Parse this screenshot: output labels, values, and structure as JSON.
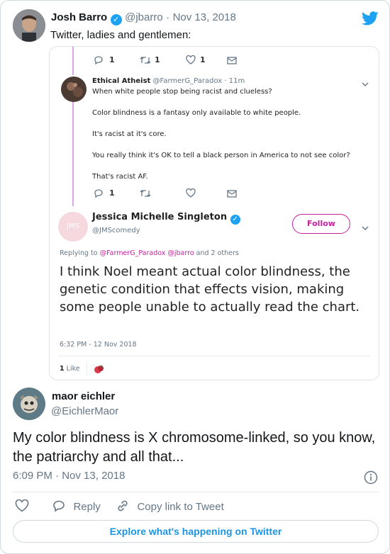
{
  "outer_tweet": {
    "author_name": "Josh Barro",
    "author_handle": "@jbarro",
    "separator": "·",
    "date": "Nov 13, 2018",
    "text": "Twitter, ladies and gentlemen:"
  },
  "screenshot": {
    "action_row_1": {
      "reply_count": "1",
      "retweet_count": "1",
      "like_count": "1"
    },
    "reply_tweet": {
      "author_name": "Ethical Atheist",
      "author_handle": "@FarmerG_Paradox · 11m",
      "lines": [
        "When white people stop being racist and clueless?",
        "Color blindness is  a fantasy only available to white people.",
        "It's racist at it's core.",
        "You really think it's OK to tell a black person in America to not see color?",
        "That's racist AF."
      ]
    },
    "action_row_2": {
      "reply_count": "1"
    },
    "main_tweet": {
      "avatar_initials": "JMS",
      "author_name": "Jessica Michelle Singleton",
      "author_handle": "@JMScomedy",
      "follow_label": "Follow",
      "replying_prefix": "Replying to ",
      "replying_handles": "@FarmerG_Paradox @jbarro",
      "replying_suffix": " and 2 others",
      "text": "I think Noel meant actual color blindness, the genetic condition that effects vision, making some people unable to actually read the chart.",
      "timestamp": "6:32 PM - 12 Nov 2018",
      "likes_count": "1",
      "likes_label": "Like"
    }
  },
  "reply": {
    "author_name": "maor eichler",
    "author_handle": "@EichlerMaor",
    "text": "My color blindness is X chromosome-linked, so you know, the patriarchy and all that...",
    "time": "6:09 PM",
    "separator": "·",
    "date": "Nov 13, 2018",
    "reply_label": "Reply",
    "copy_link_label": "Copy link to Tweet",
    "explore_label": "Explore what's happening on Twitter"
  },
  "colors": {
    "twitter_blue": "#1da1f2",
    "link_blue": "#1b95e0",
    "follow_magenta": "#c7209e",
    "like_red": "#e0245e"
  },
  "icons": [
    "twitter-bird-icon",
    "verified-badge-icon",
    "reply-icon",
    "retweet-icon",
    "heart-icon",
    "message-icon",
    "chevron-down-icon",
    "info-icon",
    "link-icon"
  ]
}
